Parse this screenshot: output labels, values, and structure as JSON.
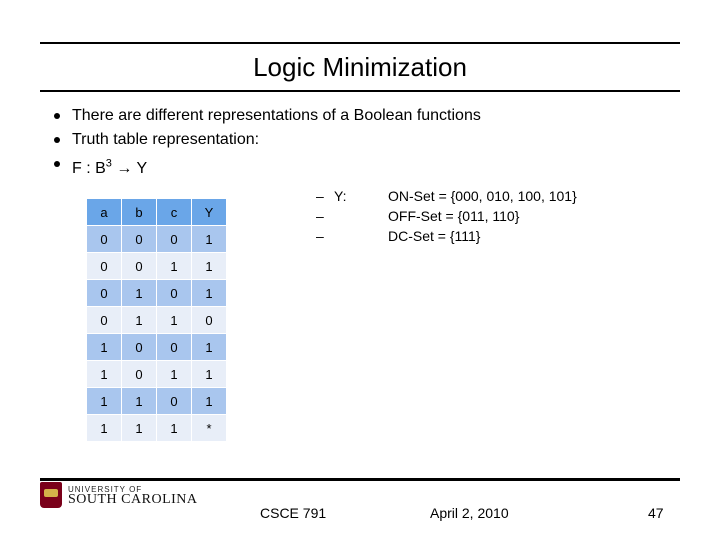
{
  "title": "Logic Minimization",
  "bullets": [
    "There are different representations of a Boolean functions",
    "Truth table representation:",
    "F : B  → Y"
  ],
  "f_sup": "3",
  "table": {
    "headers": [
      "a",
      "b",
      "c",
      "Y"
    ],
    "rows": [
      [
        "0",
        "0",
        "0",
        "1"
      ],
      [
        "0",
        "0",
        "1",
        "1"
      ],
      [
        "0",
        "1",
        "0",
        "1"
      ],
      [
        "0",
        "1",
        "1",
        "0"
      ],
      [
        "1",
        "0",
        "0",
        "1"
      ],
      [
        "1",
        "0",
        "1",
        "1"
      ],
      [
        "1",
        "1",
        "0",
        "1"
      ],
      [
        "1",
        "1",
        "1",
        "*"
      ]
    ]
  },
  "sets": {
    "dash": "–",
    "ylabel": "Y:",
    "lines": [
      "ON-Set = {000, 010, 100, 101}",
      "OFF-Set = {011, 110}",
      "DC-Set = {111}"
    ]
  },
  "footer": {
    "course": "CSCE 791",
    "date": "April 2, 2010",
    "page": "47"
  },
  "logo": {
    "top": "UNIVERSITY OF",
    "bottom": "SOUTH CAROLINA"
  },
  "chart_data": {
    "type": "table",
    "title": "Truth table for F : B^3 → Y",
    "columns": [
      "a",
      "b",
      "c",
      "Y"
    ],
    "rows": [
      [
        0,
        0,
        0,
        1
      ],
      [
        0,
        0,
        1,
        1
      ],
      [
        0,
        1,
        0,
        1
      ],
      [
        0,
        1,
        1,
        0
      ],
      [
        1,
        0,
        0,
        1
      ],
      [
        1,
        0,
        1,
        1
      ],
      [
        1,
        1,
        0,
        1
      ],
      [
        1,
        1,
        1,
        "*"
      ]
    ],
    "sets": {
      "ON": [
        "000",
        "010",
        "100",
        "101"
      ],
      "OFF": [
        "011",
        "110"
      ],
      "DC": [
        "111"
      ]
    }
  }
}
